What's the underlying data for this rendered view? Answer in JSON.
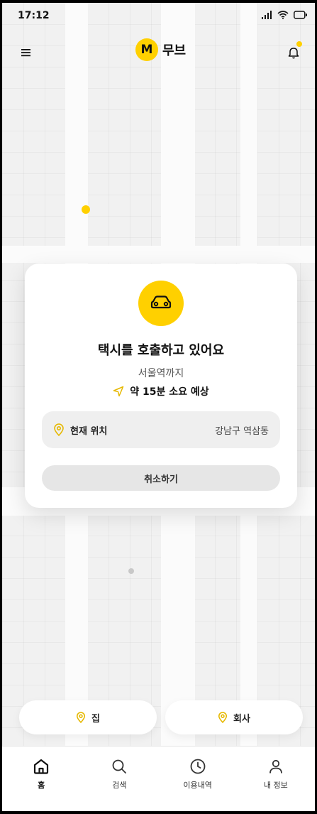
{
  "status_bar": {
    "time": "17:12"
  },
  "header": {
    "logo_letter": "M",
    "app_name": "무브"
  },
  "card": {
    "title": "택시를 호출하고 있어요",
    "destination": "서울역까지",
    "eta": "약 15분 소요 예상",
    "location_label": "현재 위치",
    "location_value": "강남구 역삼동",
    "cancel_label": "취소하기"
  },
  "quick_destinations": [
    {
      "label": "집"
    },
    {
      "label": "회사"
    }
  ],
  "bottom_nav": {
    "items": [
      {
        "label": "홈",
        "icon": "home-icon",
        "active": true
      },
      {
        "label": "검색",
        "icon": "search-icon",
        "active": false
      },
      {
        "label": "이용내역",
        "icon": "history-icon",
        "active": false
      },
      {
        "label": "내 정보",
        "icon": "profile-icon",
        "active": false
      }
    ]
  },
  "colors": {
    "accent": "#ffd000",
    "background": "#f1f1f1"
  }
}
